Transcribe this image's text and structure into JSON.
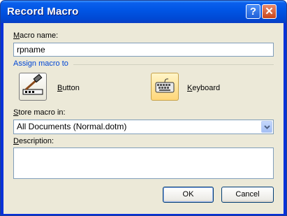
{
  "window": {
    "title": "Record Macro",
    "help_glyph": "?",
    "close_glyph": "✕"
  },
  "macro_name": {
    "label_key": "M",
    "label_rest": "acro name:",
    "value": "rpname"
  },
  "assign": {
    "title": "Assign macro to",
    "button_label_key": "B",
    "button_label_rest": "utton",
    "keyboard_label_key": "K",
    "keyboard_label_rest": "eyboard",
    "button_icon": "hammer-toolbar-icon",
    "keyboard_icon": "keyboard-icon"
  },
  "store": {
    "label_key": "S",
    "label_rest": "tore macro in:",
    "selected": "All Documents (Normal.dotm)"
  },
  "description": {
    "label_key": "D",
    "label_rest": "escription:",
    "value": ""
  },
  "buttons": {
    "ok": "OK",
    "cancel": "Cancel"
  },
  "colors": {
    "titlebar": "#0054e3",
    "dialog_bg": "#ece9d8",
    "group_title": "#0046d5"
  }
}
